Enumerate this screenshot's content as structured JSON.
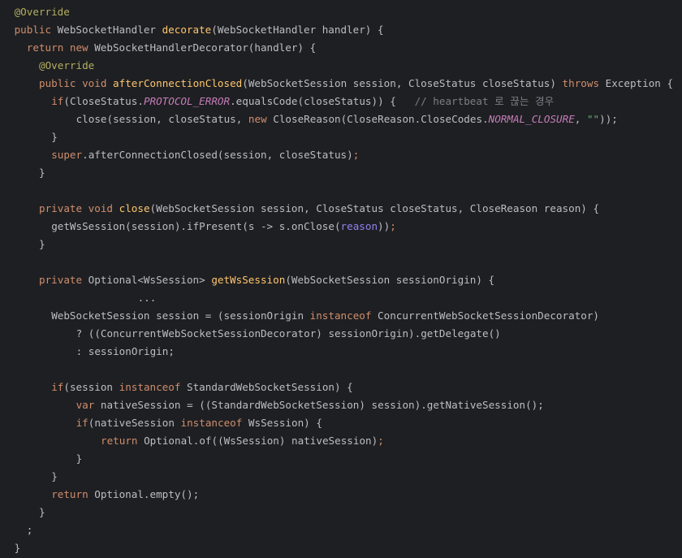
{
  "editor": {
    "colors": {
      "background": "#1e1f22",
      "text": "#bcbec4",
      "annotation": "#b3ae60",
      "keyword": "#cf8e6d",
      "method_declaration": "#ffc66d",
      "constant": "#c77dbb",
      "parameter": "#8f83f0",
      "string": "#6aab73",
      "comment": "#7a7e85"
    },
    "lines": [
      {
        "indent": 1,
        "tokens": [
          {
            "t": "@Override",
            "k": "annotation"
          }
        ]
      },
      {
        "indent": 1,
        "tokens": [
          {
            "t": "public",
            "k": "keyword"
          },
          {
            "t": " WebSocketHandler ",
            "k": "plain"
          },
          {
            "t": "decorate",
            "k": "method-decl"
          },
          {
            "t": "(WebSocketHandler handler) {",
            "k": "plain"
          }
        ]
      },
      {
        "indent": 3,
        "tokens": [
          {
            "t": "return",
            "k": "keyword"
          },
          {
            "t": " ",
            "k": "plain"
          },
          {
            "t": "new",
            "k": "keyword"
          },
          {
            "t": " WebSocketHandlerDecorator(handler) {",
            "k": "plain"
          }
        ]
      },
      {
        "indent": 5,
        "tokens": [
          {
            "t": "@Override",
            "k": "annotation"
          }
        ]
      },
      {
        "indent": 5,
        "tokens": [
          {
            "t": "public",
            "k": "keyword"
          },
          {
            "t": " ",
            "k": "plain"
          },
          {
            "t": "void",
            "k": "keyword"
          },
          {
            "t": " ",
            "k": "plain"
          },
          {
            "t": "afterConnectionClosed",
            "k": "method-decl"
          },
          {
            "t": "(WebSocketSession session, CloseStatus closeStatus) ",
            "k": "plain"
          },
          {
            "t": "throws",
            "k": "keyword"
          },
          {
            "t": " Exception {",
            "k": "plain"
          }
        ]
      },
      {
        "indent": 7,
        "tokens": [
          {
            "t": "if",
            "k": "keyword"
          },
          {
            "t": "(CloseStatus.",
            "k": "plain"
          },
          {
            "t": "PROTOCOL_ERROR",
            "k": "const"
          },
          {
            "t": ".equalsCode(closeStatus)) {   ",
            "k": "plain"
          },
          {
            "t": "// heartbeat 로 끊는 경우",
            "k": "comment"
          }
        ]
      },
      {
        "indent": 11,
        "tokens": [
          {
            "t": "close(session, closeStatus, ",
            "k": "plain"
          },
          {
            "t": "new",
            "k": "keyword"
          },
          {
            "t": " CloseReason(CloseReason.CloseCodes.",
            "k": "plain"
          },
          {
            "t": "NORMAL_CLOSURE",
            "k": "const"
          },
          {
            "t": ", ",
            "k": "plain"
          },
          {
            "t": "\"\"",
            "k": "string"
          },
          {
            "t": "));",
            "k": "plain"
          }
        ]
      },
      {
        "indent": 7,
        "tokens": [
          {
            "t": "}",
            "k": "plain"
          }
        ]
      },
      {
        "indent": 7,
        "tokens": [
          {
            "t": "super",
            "k": "keyword"
          },
          {
            "t": ".afterConnectionClosed(session, closeStatus)",
            "k": "plain"
          },
          {
            "t": ";",
            "k": "semi"
          }
        ]
      },
      {
        "indent": 5,
        "tokens": [
          {
            "t": "}",
            "k": "plain"
          }
        ]
      },
      {
        "indent": 0,
        "tokens": []
      },
      {
        "indent": 5,
        "tokens": [
          {
            "t": "private",
            "k": "keyword"
          },
          {
            "t": " ",
            "k": "plain"
          },
          {
            "t": "void",
            "k": "keyword"
          },
          {
            "t": " ",
            "k": "plain"
          },
          {
            "t": "close",
            "k": "method-decl"
          },
          {
            "t": "(WebSocketSession session, CloseStatus closeStatus, CloseReason reason) {",
            "k": "plain"
          }
        ]
      },
      {
        "indent": 7,
        "tokens": [
          {
            "t": "getWsSession(session).ifPresent(s -> s.onClose(",
            "k": "plain"
          },
          {
            "t": "reason",
            "k": "param"
          },
          {
            "t": "))",
            "k": "plain"
          },
          {
            "t": ";",
            "k": "semi"
          }
        ]
      },
      {
        "indent": 5,
        "tokens": [
          {
            "t": "}",
            "k": "plain"
          }
        ]
      },
      {
        "indent": 0,
        "tokens": []
      },
      {
        "indent": 5,
        "tokens": [
          {
            "t": "private",
            "k": "keyword"
          },
          {
            "t": " Optional<WsSession> ",
            "k": "plain"
          },
          {
            "t": "getWsSession",
            "k": "method-decl"
          },
          {
            "t": "(WebSocketSession sessionOrigin) {",
            "k": "plain"
          }
        ]
      },
      {
        "indent": 21,
        "tokens": [
          {
            "t": "...",
            "k": "plain"
          }
        ]
      },
      {
        "indent": 7,
        "tokens": [
          {
            "t": "WebSocketSession session = (sessionOrigin ",
            "k": "plain"
          },
          {
            "t": "instanceof",
            "k": "keyword"
          },
          {
            "t": " ConcurrentWebSocketSessionDecorator)",
            "k": "plain"
          }
        ]
      },
      {
        "indent": 11,
        "tokens": [
          {
            "t": "? ((ConcurrentWebSocketSessionDecorator) sessionOrigin).getDelegate()",
            "k": "plain"
          }
        ]
      },
      {
        "indent": 11,
        "tokens": [
          {
            "t": ": sessionOrigin;",
            "k": "plain"
          }
        ]
      },
      {
        "indent": 0,
        "tokens": []
      },
      {
        "indent": 7,
        "tokens": [
          {
            "t": "if",
            "k": "keyword"
          },
          {
            "t": "(session ",
            "k": "plain"
          },
          {
            "t": "instanceof",
            "k": "keyword"
          },
          {
            "t": " StandardWebSocketSession) {",
            "k": "plain"
          }
        ]
      },
      {
        "indent": 11,
        "tokens": [
          {
            "t": "var",
            "k": "keyword"
          },
          {
            "t": " nativeSession = ((StandardWebSocketSession) session).getNativeSession();",
            "k": "plain"
          }
        ]
      },
      {
        "indent": 11,
        "tokens": [
          {
            "t": "if",
            "k": "keyword"
          },
          {
            "t": "(nativeSession ",
            "k": "plain"
          },
          {
            "t": "instanceof",
            "k": "keyword"
          },
          {
            "t": " WsSession) {",
            "k": "plain"
          }
        ]
      },
      {
        "indent": 15,
        "tokens": [
          {
            "t": "return",
            "k": "keyword"
          },
          {
            "t": " Optional.of((WsSession) nativeSession)",
            "k": "plain"
          },
          {
            "t": ";",
            "k": "semi"
          }
        ]
      },
      {
        "indent": 11,
        "tokens": [
          {
            "t": "}",
            "k": "plain"
          }
        ]
      },
      {
        "indent": 7,
        "tokens": [
          {
            "t": "}",
            "k": "plain"
          }
        ]
      },
      {
        "indent": 7,
        "tokens": [
          {
            "t": "return",
            "k": "keyword"
          },
          {
            "t": " Optional.empty();",
            "k": "plain"
          }
        ]
      },
      {
        "indent": 5,
        "tokens": [
          {
            "t": "}",
            "k": "plain"
          }
        ]
      },
      {
        "indent": 3,
        "tokens": [
          {
            "t": ";",
            "k": "plain"
          }
        ]
      },
      {
        "indent": 1,
        "tokens": [
          {
            "t": "}",
            "k": "plain"
          }
        ]
      }
    ]
  }
}
